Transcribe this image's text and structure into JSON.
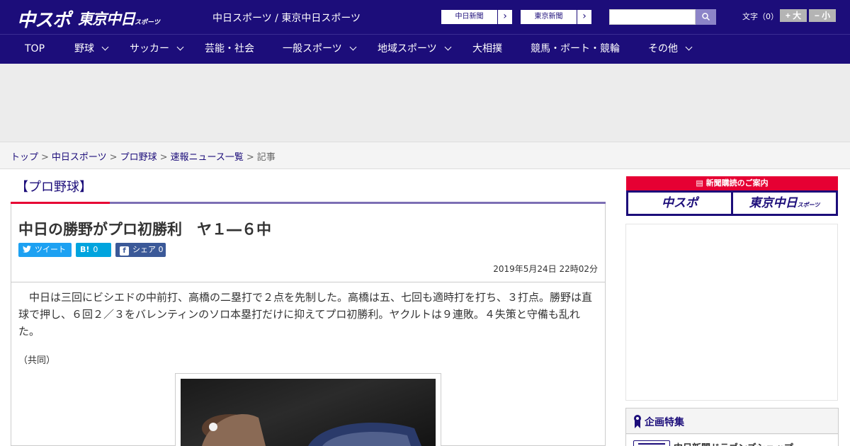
{
  "header": {
    "logo_chuspo": "中スポ",
    "logo_tokyo": "東京中日",
    "logo_tokyo_sub": "スポーツ",
    "site_title": "中日スポーツ / 東京中日スポーツ",
    "paper_links": [
      "中日新聞",
      "東京新聞"
    ],
    "search_placeholder": "",
    "font_size_label": "文字（0）",
    "font_larger": "+ 大",
    "font_smaller": "− 小",
    "colors": {
      "primary": "#1c0d7a",
      "accent_red": "#e60033"
    }
  },
  "nav": {
    "items": [
      {
        "label": "TOP"
      },
      {
        "label": "野球"
      },
      {
        "label": "サッカー"
      },
      {
        "label": "芸能・社会"
      },
      {
        "label": "一般スポーツ"
      },
      {
        "label": "地域スポーツ"
      },
      {
        "label": "大相撲"
      },
      {
        "label": "競馬・ボート・競輪"
      },
      {
        "label": "その他"
      }
    ]
  },
  "breadcrumb": {
    "items": [
      "トップ",
      "中日スポーツ",
      "プロ野球",
      "速報ニュース一覧"
    ],
    "current": "記事",
    "separator": ">"
  },
  "article": {
    "category": "【プロ野球】",
    "headline": "中日の勝野がプロ初勝利　ヤ１―６中",
    "share": {
      "tweet": "ツイート",
      "hatena_icon": "B!",
      "hatena_count": "0",
      "facebook_label": "シェア",
      "facebook_count": "0"
    },
    "date": "2019年5月24日 22時02分",
    "body": "中日は三回にビシエドの中前打、高橋の二塁打で２点を先制した。高橋は五、七回も適時打を打ち、３打点。勝野は直球で押し、６回２／３をバレンティンのソロ本塁打だけに抑えてプロ初勝利。ヤクルトは９連敗。４失策と守備も乱れた。",
    "credit": "（共同）"
  },
  "sidebar": {
    "subscription_title": "新聞購読のご案内",
    "sub_chuspo": "中スポ",
    "sub_tokyo": "東京中日",
    "sub_tokyo_small": "スポーツ",
    "feature_title": "企画特集",
    "feature_item": "中日新聞ドラゴンズショップ"
  }
}
